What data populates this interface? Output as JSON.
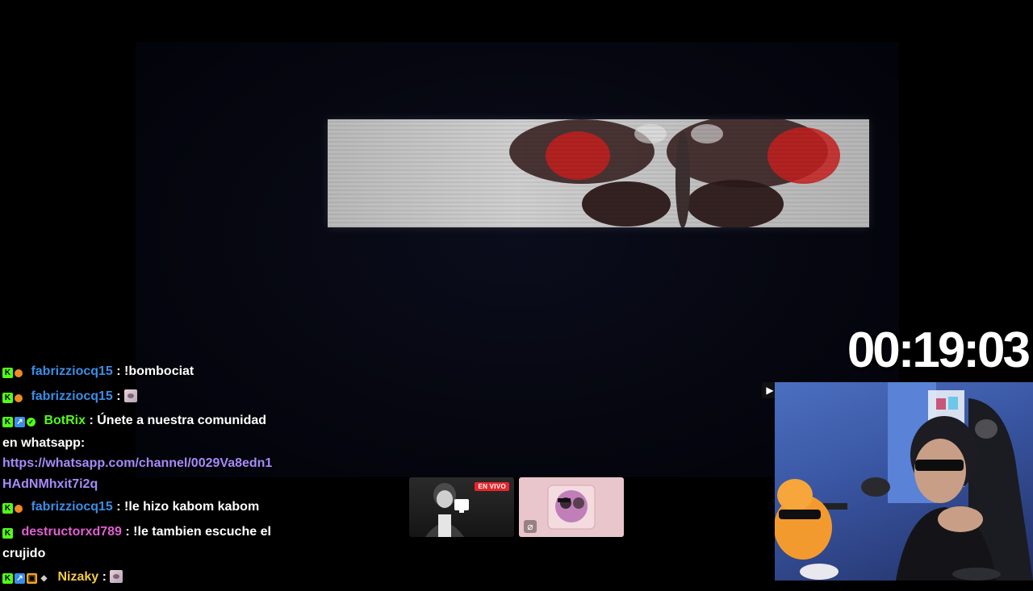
{
  "timer": {
    "text": "00:19:03"
  },
  "chat": {
    "messages": [
      {
        "badges": [
          "kick-badge",
          "orange-dot-badge"
        ],
        "user": "fabrizziocq15",
        "user_color": "#3b8de6",
        "text": ": !bombociat",
        "emote": false,
        "link": "",
        "tail": ""
      },
      {
        "badges": [
          "kick-badge",
          "orange-dot-badge"
        ],
        "user": "fabrizziocq15",
        "user_color": "#3b8de6",
        "text": ": ",
        "emote": true,
        "link": "",
        "tail": ""
      },
      {
        "badges": [
          "kick-badge",
          "blue-arrow-badge",
          "verified-badge"
        ],
        "user": "BotRix",
        "user_color": "#53fc18",
        "text": ": Únete a nuestra comunidad en whatsapp:",
        "emote": false,
        "link": "https://whatsapp.com/channel/0029Va8edn1HAdNMhxit7i2q",
        "tail": ""
      },
      {
        "badges": [
          "kick-badge",
          "orange-dot-badge"
        ],
        "user": "fabrizziocq15",
        "user_color": "#3b8de6",
        "text": ": !le hizo kabom kabom",
        "emote": false,
        "link": "",
        "tail": ""
      },
      {
        "badges": [
          "kick-badge"
        ],
        "user": "destructorxd789",
        "user_color": "#e05fd1",
        "text": ": !le tambien escuche el crujido",
        "emote": false,
        "link": "",
        "tail": ""
      },
      {
        "badges": [
          "kick-badge",
          "blue-arrow-badge",
          "gift-badge",
          "fox-badge"
        ],
        "user": "Nizaky",
        "user_color": "#f2c94c",
        "text": ": ",
        "emote": true,
        "link": "",
        "tail": ""
      }
    ]
  },
  "thumbnails": [
    {
      "live_label": "EN VIVO"
    },
    {
      "live_label": ""
    }
  ],
  "colors": {
    "kick_green": "#53fc18",
    "live_red": "#e5262a",
    "link_purple": "#a78bfa",
    "game_bg": "#05060f"
  }
}
